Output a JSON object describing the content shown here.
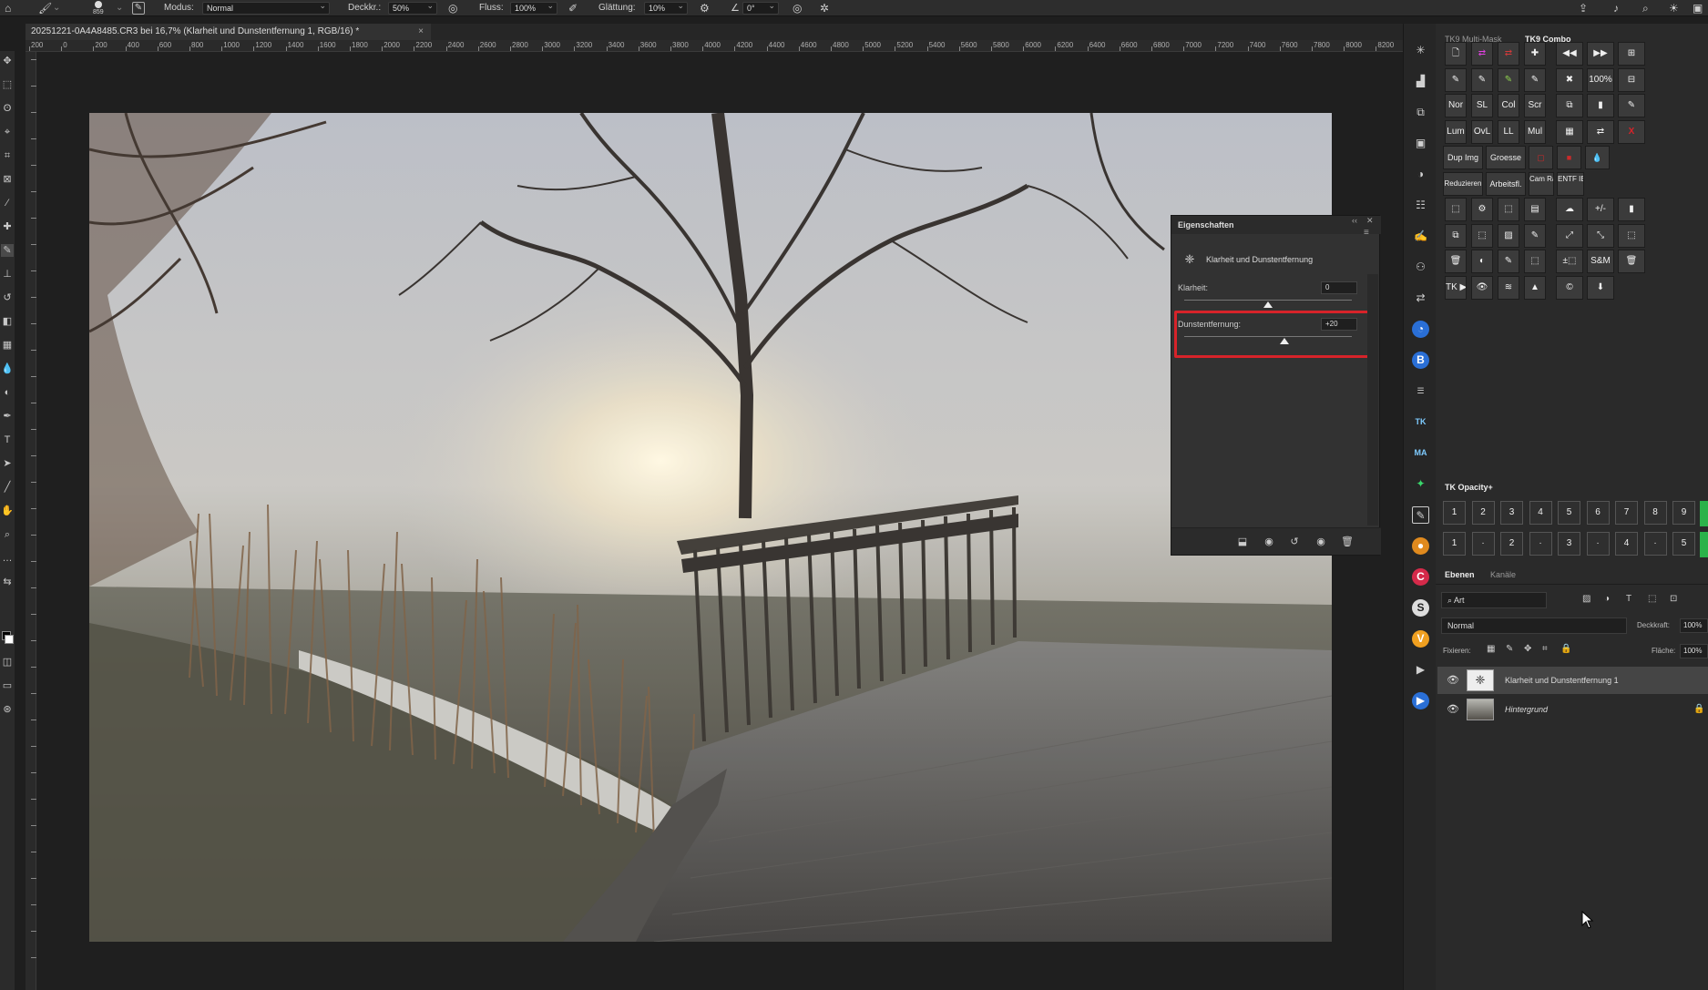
{
  "options_bar": {
    "brush_size": "859",
    "mode_label": "Modus:",
    "mode_value": "Normal",
    "opacity_label": "Deckkr.:",
    "opacity_value": "50%",
    "flow_label": "Fluss:",
    "flow_value": "100%",
    "smoothing_label": "Glättung:",
    "smoothing_value": "10%",
    "angle_value": "0°"
  },
  "document_tab": {
    "title": "20251221-0A4A8485.CR3 bei 16,7% (Klarheit und Dunstentfernung 1, RGB/16) *",
    "close": "×"
  },
  "ruler": {
    "h_ticks": [
      "200",
      "0",
      "200",
      "400",
      "600",
      "800",
      "1000",
      "1200",
      "1400",
      "1600",
      "1800",
      "2000",
      "2200",
      "2400",
      "2600",
      "2800",
      "3000",
      "3200",
      "3400",
      "3600",
      "3800",
      "4000",
      "4200",
      "4400",
      "4600",
      "4800",
      "5000",
      "5200",
      "5400",
      "5600",
      "5800",
      "6000",
      "6200",
      "6400",
      "6600",
      "6800",
      "7000",
      "7200",
      "7400",
      "7600",
      "7800",
      "8000",
      "8200",
      "8400"
    ]
  },
  "properties": {
    "title": "Eigenschaften",
    "adjustment_name": "Klarheit und Dunstentfernung",
    "clarity_label": "Klarheit:",
    "clarity_value": "0",
    "clarity_level": 0,
    "dehaze_label": "Dunstentfernung:",
    "dehaze_value": "+20",
    "dehaze_level": 20
  },
  "panel_tabs": {
    "tab1": "TK9 Multi-Mask",
    "tab2": "TK9 Combo"
  },
  "tk9_buttons": [
    [
      "",
      "",
      "",
      "",
      "",
      "",
      ""
    ],
    [
      "",
      "",
      "",
      "",
      "",
      "100%",
      ""
    ],
    [
      "Nor",
      "SL",
      "Col",
      "Scr",
      "",
      "",
      ""
    ],
    [
      "Lum",
      "OvL",
      "LL",
      "Mul",
      "",
      "",
      "X"
    ],
    [
      "Dup Img",
      "Groesse",
      "",
      "",
      ""
    ],
    [
      "Reduzieren",
      "Arbeitsfl.",
      "Cam Raw",
      "ENTF IBF"
    ],
    [
      "",
      "",
      "",
      "",
      "",
      "+/-",
      ""
    ],
    [
      "",
      "",
      "",
      "",
      "",
      "",
      ""
    ],
    [
      "",
      "",
      "",
      "",
      "±⬚",
      "S&M",
      ""
    ],
    [
      "TK ▶",
      "",
      "",
      "",
      "©",
      ""
    ]
  ],
  "opacity_panel": {
    "title": "TK Opacity+",
    "row1": [
      "1",
      "2",
      "3",
      "4",
      "5",
      "6",
      "7",
      "8",
      "9"
    ],
    "row2": [
      "1",
      "·",
      "2",
      "·",
      "3",
      "·",
      "4",
      "·",
      "5"
    ]
  },
  "layers_panel": {
    "tab_layers": "Ebenen",
    "tab_channels": "Kanäle",
    "filter_label": "Art",
    "blend_mode": "Normal",
    "opacity_label": "Deckkraft:",
    "opacity_value": "100%",
    "lock_label": "Fixieren:",
    "fill_label": "Fläche:",
    "fill_value": "100%",
    "layers": [
      {
        "name": "Klarheit und Dunstentfernung 1",
        "visible": true
      },
      {
        "name": "Hintergrund",
        "visible": true
      }
    ]
  },
  "colors": {
    "highlight_red": "#d7232a",
    "swap_magenta": "#e040e0",
    "green_brush": "#8fd14f",
    "red_button": "#cc2a2a",
    "blue_icon": "#2a6fd6"
  }
}
